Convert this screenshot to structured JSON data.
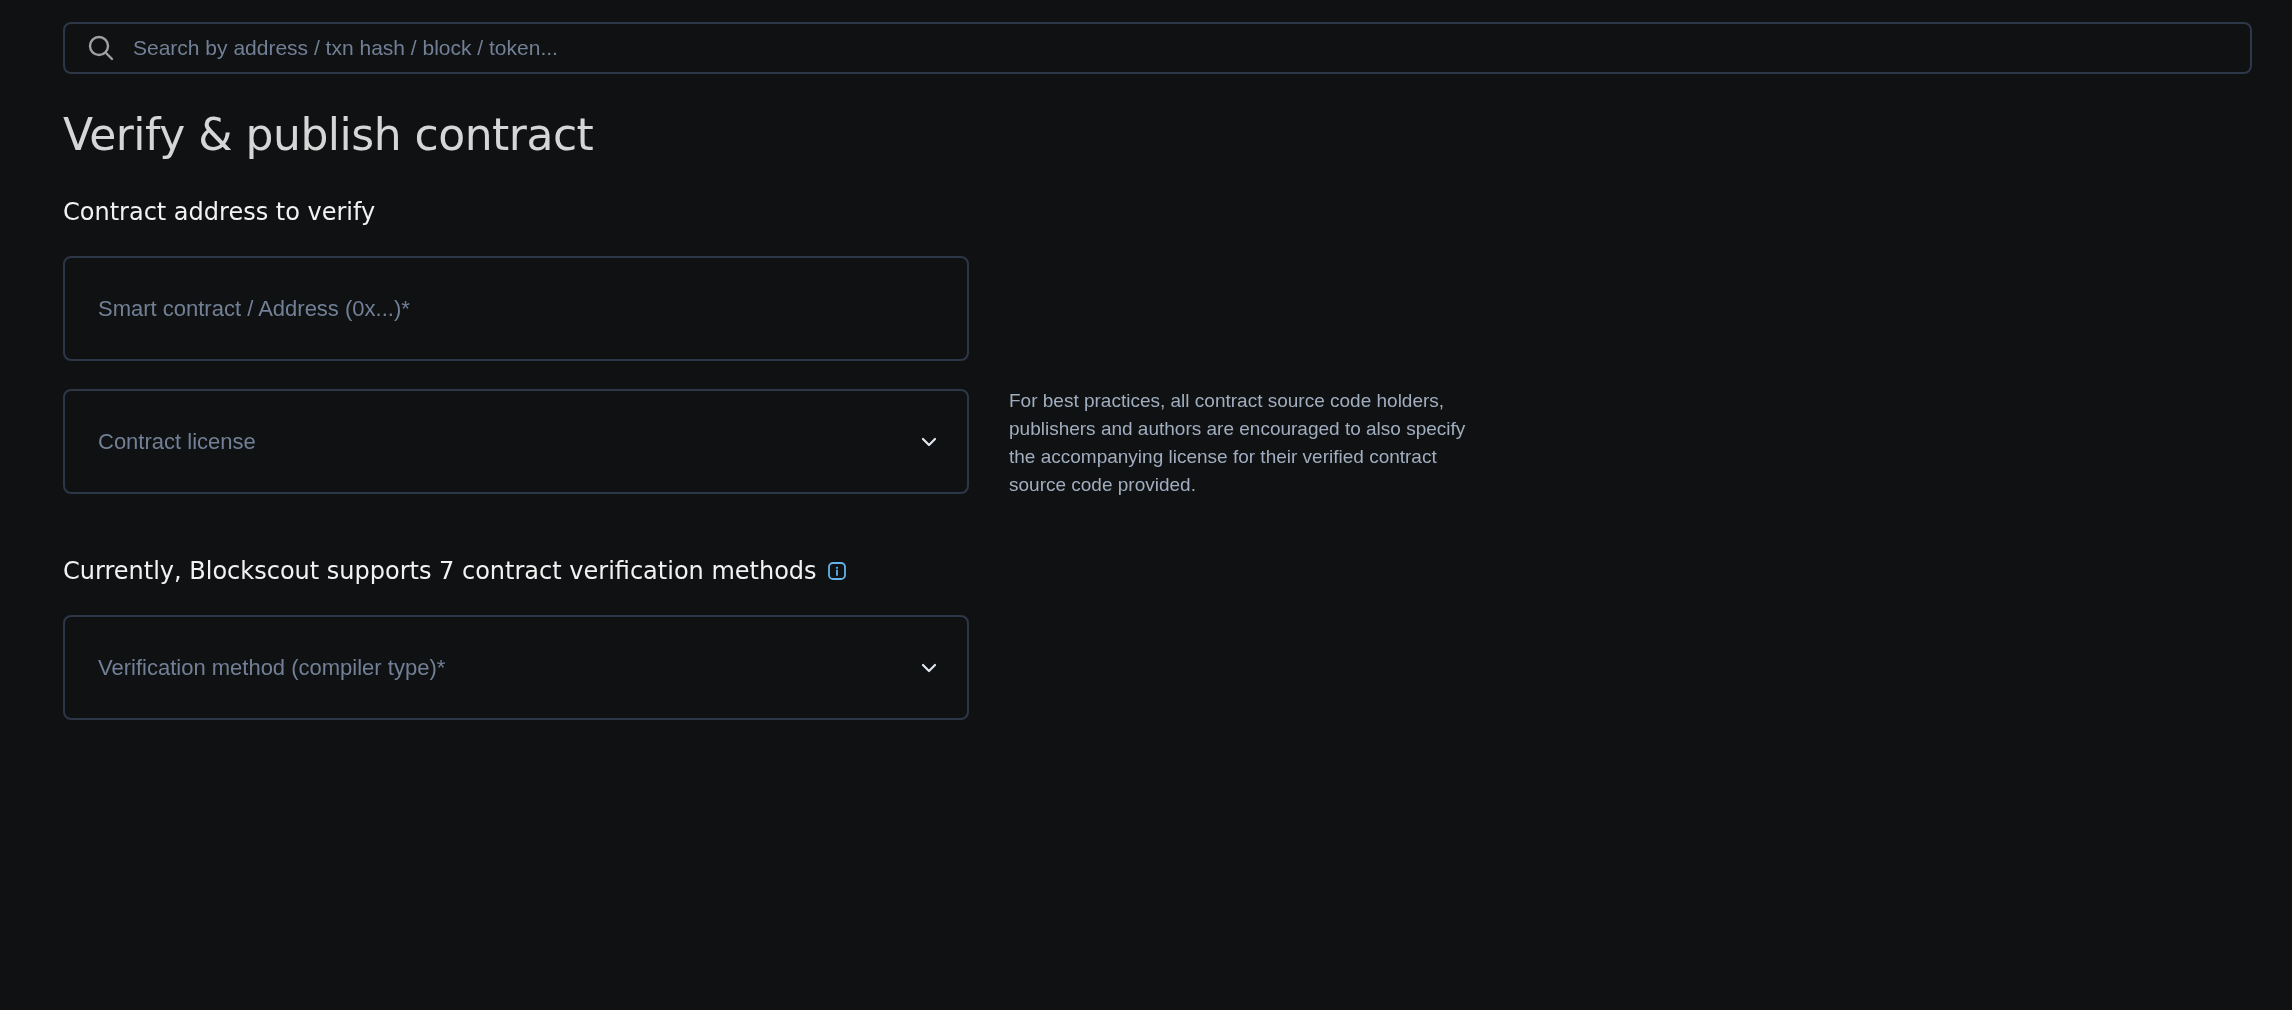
{
  "search": {
    "placeholder": "Search by address / txn hash / block / token..."
  },
  "title": "Verify & publish contract",
  "sections": [
    {
      "heading": "Contract address to verify",
      "info": false,
      "fields": [
        {
          "kind": "input",
          "placeholder": "Smart contract / Address (0x...)*"
        },
        {
          "kind": "select",
          "placeholder": "Contract license",
          "help": "For best practices, all contract source code holders, publishers and authors are encouraged to also specify the accompanying license for their verified contract source code provided."
        }
      ]
    },
    {
      "heading": "Currently, Blockscout supports 7 contract verification methods",
      "info": true,
      "fields": [
        {
          "kind": "select",
          "placeholder": "Verification method (compiler type)*"
        }
      ]
    }
  ]
}
